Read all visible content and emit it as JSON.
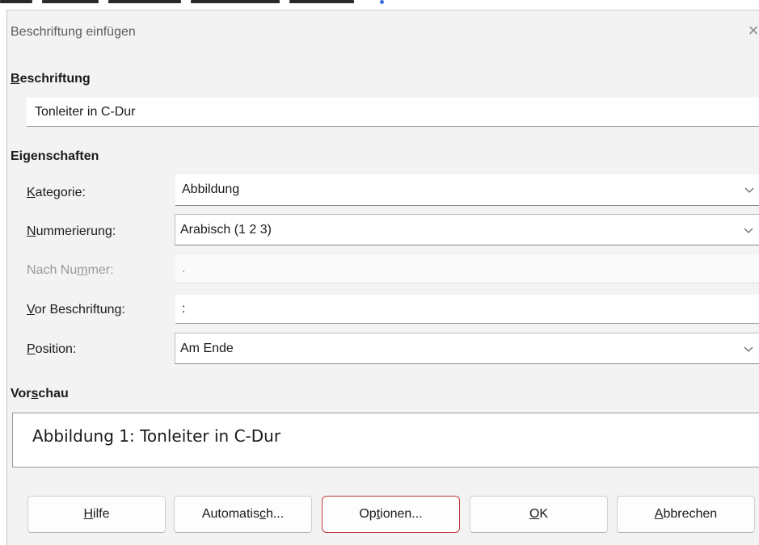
{
  "dialog": {
    "title": "Beschriftung einfügen",
    "close_glyph": "×"
  },
  "caption": {
    "heading_accel": "B",
    "heading_rest": "eschriftung",
    "value": "Tonleiter in C-Dur"
  },
  "properties": {
    "heading": "Eigenschaften",
    "category": {
      "label_accel": "K",
      "label_rest": "ategorie:",
      "value": "Abbildung"
    },
    "numbering": {
      "label_accel": "N",
      "label_rest": "ummerierung:",
      "value": "Arabisch (1 2 3)"
    },
    "after_number": {
      "label_pre": "Nach Nu",
      "label_accel": "m",
      "label_rest": "mer:",
      "value": "."
    },
    "before_caption": {
      "label_accel": "V",
      "label_rest": "or Beschriftung:",
      "value": ":"
    },
    "position": {
      "label_accel": "P",
      "label_rest": "osition:",
      "value": "Am Ende"
    }
  },
  "preview": {
    "heading_pre": "Vor",
    "heading_accel": "s",
    "heading_rest": "chau",
    "text": "Abbildung 1: Tonleiter in C-Dur"
  },
  "buttons": {
    "help": {
      "accel": "H",
      "rest": "ilfe"
    },
    "auto": {
      "pre": "Automatis",
      "accel": "c",
      "rest": "h..."
    },
    "options": {
      "pre": "Op",
      "accel": "t",
      "rest": "ionen..."
    },
    "ok": {
      "accel": "O",
      "rest": "K"
    },
    "cancel": {
      "accel": "A",
      "rest": "bbrechen"
    }
  },
  "colors": {
    "dialog_bg": "#f3f3f3",
    "focus_ring": "#c43a3a"
  },
  "icons": {
    "close": "close-icon",
    "dropdown": "chevron-down-icon"
  }
}
